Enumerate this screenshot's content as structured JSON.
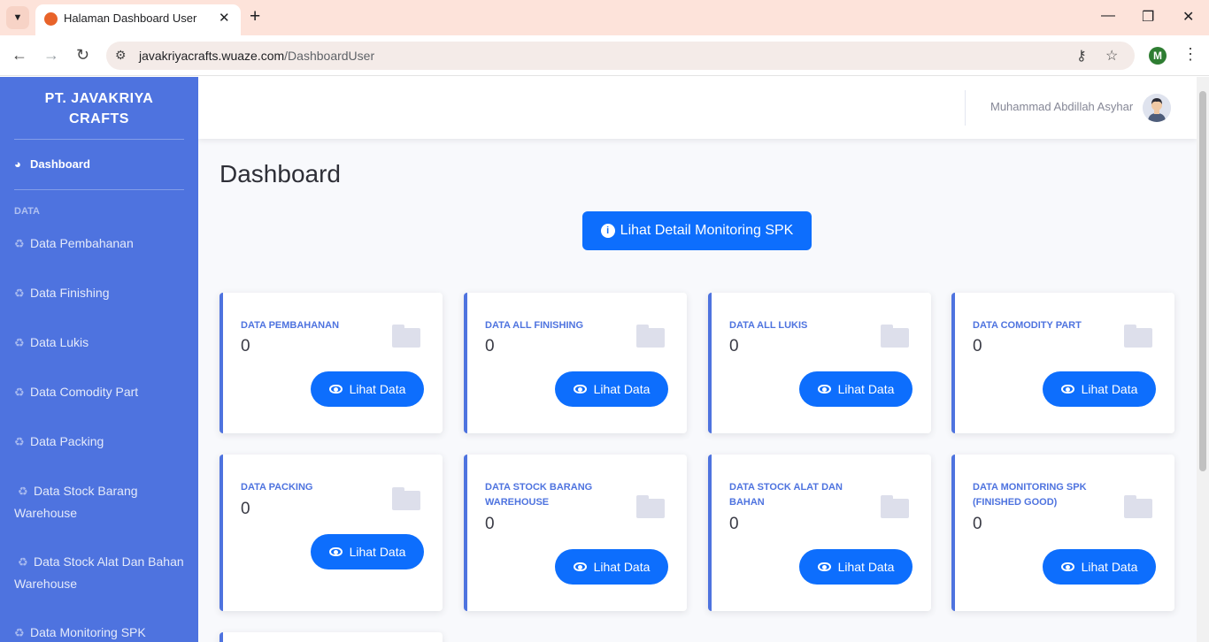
{
  "browser": {
    "tab_title": "Halaman Dashboard User",
    "url_host": "javakriyacrafts.wuaze.com",
    "url_path": "/DashboardUser",
    "profile_initial": "M"
  },
  "sidebar": {
    "brand_line1": "PT. JAVAKRIYA",
    "brand_line2": "CRAFTS",
    "dashboard_label": "Dashboard",
    "heading": "DATA",
    "items": [
      {
        "label": "Data Pembahanan"
      },
      {
        "label": "Data Finishing"
      },
      {
        "label": "Data Lukis"
      },
      {
        "label": "Data Comodity Part"
      },
      {
        "label": "Data Packing"
      },
      {
        "label": "Data Stock Barang Warehouse"
      },
      {
        "label": "Data Stock Alat Dan Bahan Warehouse"
      },
      {
        "label": "Data Monitoring SPK"
      }
    ]
  },
  "topbar": {
    "username": "Muhammad Abdillah Asyhar"
  },
  "main": {
    "page_title": "Dashboard",
    "monitor_button": "Lihat Detail Monitoring SPK",
    "view_label": "Lihat Data",
    "cards": [
      {
        "title": "DATA PEMBAHANAN",
        "value": "0"
      },
      {
        "title": "DATA ALL FINISHING",
        "value": "0"
      },
      {
        "title": "DATA ALL LUKIS",
        "value": "0"
      },
      {
        "title": "DATA COMODITY PART",
        "value": "0"
      },
      {
        "title": "DATA PACKING",
        "value": "0"
      },
      {
        "title": "DATA STOCK BARANG WAREHOUSE",
        "value": "0"
      },
      {
        "title": "DATA STOCK ALAT DAN BAHAN",
        "value": "0"
      },
      {
        "title": "DATA MONITORING SPK (FINISHED GOOD)",
        "value": "0"
      }
    ]
  },
  "colors": {
    "sidebar_bg": "#4e73df",
    "primary_button": "#0d6efd",
    "tabbar_bg": "#fde3da"
  }
}
